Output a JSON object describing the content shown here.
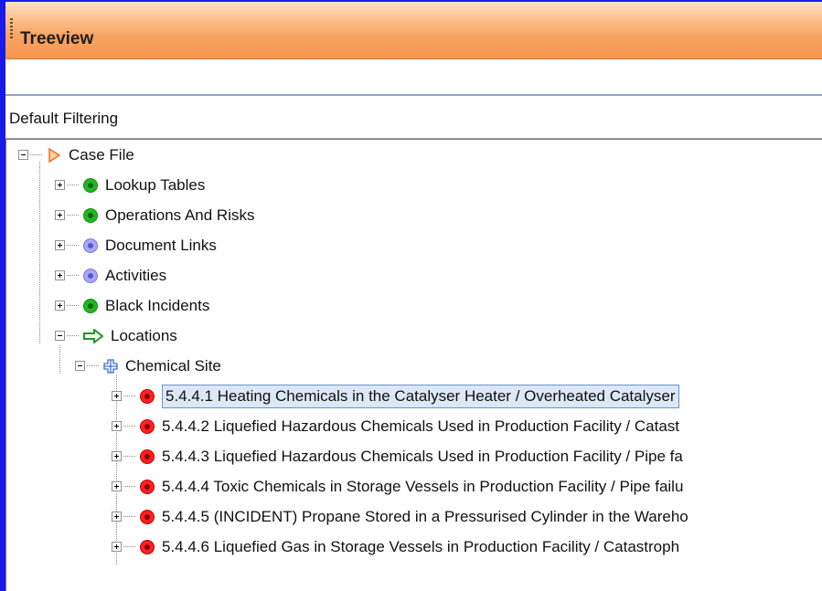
{
  "panel": {
    "title": "Treeview"
  },
  "search": {
    "value": ""
  },
  "filter": {
    "label": "Default Filtering"
  },
  "tree": {
    "root": {
      "label": "Case File",
      "icon": "orange-triangle-icon",
      "expanded": true
    },
    "children": [
      {
        "label": "Lookup Tables",
        "icon": "green-dot-icon"
      },
      {
        "label": "Operations And Risks",
        "icon": "green-dot-icon"
      },
      {
        "label": "Document Links",
        "icon": "blue-dot-icon"
      },
      {
        "label": "Activities",
        "icon": "blue-dot-icon"
      },
      {
        "label": "Black Incidents",
        "icon": "green-dot-icon"
      }
    ],
    "locations": {
      "label": "Locations",
      "icon": "green-arrow-icon",
      "site": {
        "label": "Chemical Site",
        "icon": "blue-cross-icon",
        "items": [
          {
            "label": "5.4.4.1 Heating Chemicals in the Catalyser Heater / Overheated Catalyser",
            "selected": true
          },
          {
            "label": "5.4.4.2 Liquefied Hazardous Chemicals Used in Production Facility / Catast"
          },
          {
            "label": "5.4.4.3 Liquefied Hazardous Chemicals Used in Production Facility / Pipe fa"
          },
          {
            "label": "5.4.4.4 Toxic Chemicals in Storage Vessels in Production Facility / Pipe failu"
          },
          {
            "label": "5.4.4.5 (INCIDENT) Propane Stored in a Pressurised Cylinder in the Wareho"
          },
          {
            "label": "5.4.4.6 Liquefied Gas in Storage Vessels in Production Facility / Catastroph"
          }
        ]
      }
    }
  },
  "colors": {
    "accent_border": "#1a1ae8",
    "title_gradient_end": "#f6974f",
    "selection_bg": "#dce8f7"
  }
}
